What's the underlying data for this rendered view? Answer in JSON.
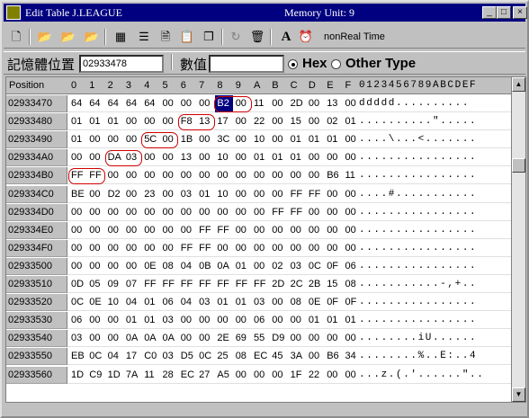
{
  "window": {
    "title": "Edit Table J.LEAGUE",
    "memory_unit": "Memory Unit: 9",
    "controls": {
      "minimize": "_",
      "maximize": "□",
      "close": "×"
    }
  },
  "toolbar": {
    "font_icon": "A",
    "non_real_time": "nonReal Time",
    "buttons": [
      "new-file-icon",
      "save-d-icon",
      "save-h-icon",
      "save-s-icon",
      "table-view-icon",
      "list-view-icon",
      "page-icon",
      "clipboard-icon",
      "copy-icon",
      "refresh-icon",
      "trash-icon",
      "font-icon",
      "alarm-icon"
    ]
  },
  "addressbar": {
    "address_label": "記憶體位置",
    "address_value": "02933478",
    "value_label": "數值",
    "value_input": "",
    "radio_hex": "Hex",
    "radio_other": "Other Type",
    "selected_type": "Hex"
  },
  "table": {
    "position_header": "Position",
    "hex_columns": [
      "0",
      "1",
      "2",
      "3",
      "4",
      "5",
      "6",
      "7",
      "8",
      "9",
      "A",
      "B",
      "C",
      "D",
      "E",
      "F"
    ],
    "ascii_header": "0123456789ABCDEF",
    "selected_cell": {
      "row": 0,
      "col": 8
    },
    "highlighted_groups": [
      {
        "row": 0,
        "cols": [
          8,
          9
        ]
      },
      {
        "row": 1,
        "cols": [
          6,
          7
        ]
      },
      {
        "row": 2,
        "cols": [
          4,
          5
        ]
      },
      {
        "row": 3,
        "cols": [
          2,
          3
        ]
      },
      {
        "row": 4,
        "cols": [
          0,
          1
        ]
      }
    ],
    "rows": [
      {
        "pos": "02933470",
        "bytes": [
          "64",
          "64",
          "64",
          "64",
          "64",
          "00",
          "00",
          "00",
          "B2",
          "00",
          "11",
          "00",
          "2D",
          "00",
          "13",
          "00"
        ],
        "ascii": "ddddd.........."
      },
      {
        "pos": "02933480",
        "bytes": [
          "01",
          "01",
          "01",
          "00",
          "00",
          "00",
          "F8",
          "13",
          "17",
          "00",
          "22",
          "00",
          "15",
          "00",
          "02",
          "01"
        ],
        "ascii": "..........\"....."
      },
      {
        "pos": "02933490",
        "bytes": [
          "01",
          "00",
          "00",
          "00",
          "5C",
          "00",
          "1B",
          "00",
          "3C",
          "00",
          "10",
          "00",
          "01",
          "01",
          "01",
          "00"
        ],
        "ascii": "....\\...<......."
      },
      {
        "pos": "029334A0",
        "bytes": [
          "00",
          "00",
          "DA",
          "03",
          "00",
          "00",
          "13",
          "00",
          "10",
          "00",
          "01",
          "01",
          "01",
          "00",
          "00",
          "00"
        ],
        "ascii": "................"
      },
      {
        "pos": "029334B0",
        "bytes": [
          "FF",
          "FF",
          "00",
          "00",
          "00",
          "00",
          "00",
          "00",
          "00",
          "00",
          "00",
          "00",
          "00",
          "00",
          "B6",
          "11"
        ],
        "ascii": "................"
      },
      {
        "pos": "029334C0",
        "bytes": [
          "BE",
          "00",
          "D2",
          "00",
          "23",
          "00",
          "03",
          "01",
          "10",
          "00",
          "00",
          "00",
          "FF",
          "FF",
          "00",
          "00"
        ],
        "ascii": "....#..........."
      },
      {
        "pos": "029334D0",
        "bytes": [
          "00",
          "00",
          "00",
          "00",
          "00",
          "00",
          "00",
          "00",
          "00",
          "00",
          "00",
          "FF",
          "FF",
          "00",
          "00",
          "00"
        ],
        "ascii": "................"
      },
      {
        "pos": "029334E0",
        "bytes": [
          "00",
          "00",
          "00",
          "00",
          "00",
          "00",
          "00",
          "FF",
          "FF",
          "00",
          "00",
          "00",
          "00",
          "00",
          "00",
          "00"
        ],
        "ascii": "................"
      },
      {
        "pos": "029334F0",
        "bytes": [
          "00",
          "00",
          "00",
          "00",
          "00",
          "00",
          "FF",
          "FF",
          "00",
          "00",
          "00",
          "00",
          "00",
          "00",
          "00",
          "00"
        ],
        "ascii": "................"
      },
      {
        "pos": "02933500",
        "bytes": [
          "00",
          "00",
          "00",
          "00",
          "0E",
          "08",
          "04",
          "0B",
          "0A",
          "01",
          "00",
          "02",
          "03",
          "0C",
          "0F",
          "06"
        ],
        "ascii": "................"
      },
      {
        "pos": "02933510",
        "bytes": [
          "0D",
          "05",
          "09",
          "07",
          "FF",
          "FF",
          "FF",
          "FF",
          "FF",
          "FF",
          "FF",
          "2D",
          "2C",
          "2B",
          "15",
          "08"
        ],
        "ascii": "...........-,+.."
      },
      {
        "pos": "02933520",
        "bytes": [
          "0C",
          "0E",
          "10",
          "04",
          "01",
          "06",
          "04",
          "03",
          "01",
          "01",
          "03",
          "00",
          "08",
          "0E",
          "0F",
          "0F"
        ],
        "ascii": "................"
      },
      {
        "pos": "02933530",
        "bytes": [
          "06",
          "00",
          "00",
          "01",
          "01",
          "03",
          "00",
          "00",
          "00",
          "00",
          "06",
          "00",
          "00",
          "01",
          "01",
          "01"
        ],
        "ascii": "................"
      },
      {
        "pos": "02933540",
        "bytes": [
          "03",
          "00",
          "00",
          "0A",
          "0A",
          "0A",
          "00",
          "00",
          "2E",
          "69",
          "55",
          "D9",
          "00",
          "00",
          "00",
          "00"
        ],
        "ascii": "........iU......"
      },
      {
        "pos": "02933550",
        "bytes": [
          "EB",
          "0C",
          "04",
          "17",
          "C0",
          "03",
          "D5",
          "0C",
          "25",
          "08",
          "EC",
          "45",
          "3A",
          "00",
          "B6",
          "34"
        ],
        "ascii": "........%..E:..4"
      },
      {
        "pos": "02933560",
        "bytes": [
          "1D",
          "C9",
          "1D",
          "7A",
          "11",
          "28",
          "EC",
          "27",
          "A5",
          "00",
          "00",
          "00",
          "1F",
          "22",
          "00",
          "00"
        ],
        "ascii": "...z.(.'......\".."
      }
    ]
  },
  "scrollbar": {
    "up": "▲",
    "down": "▼"
  }
}
